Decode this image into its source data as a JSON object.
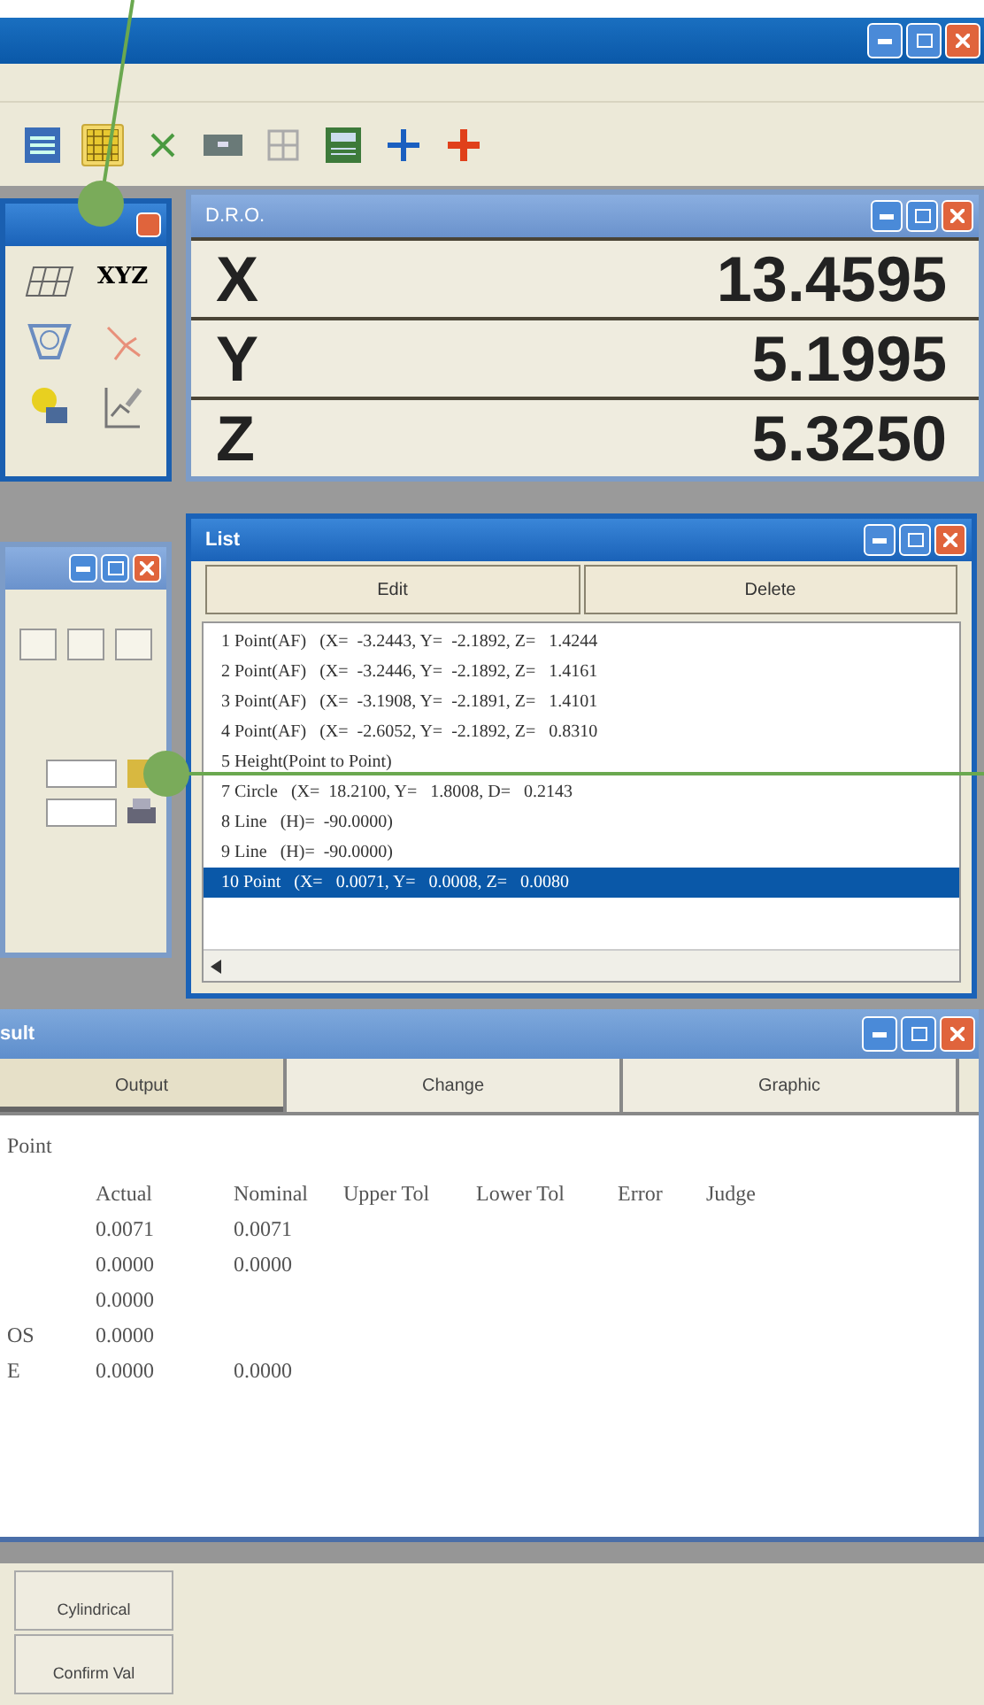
{
  "toolbar": [
    {
      "kind": "list",
      "selected": false
    },
    {
      "kind": "grid",
      "selected": true
    },
    {
      "kind": "cross",
      "selected": false
    },
    {
      "kind": "bar",
      "selected": false
    },
    {
      "kind": "panes",
      "selected": false
    },
    {
      "kind": "calc",
      "selected": false
    },
    {
      "kind": "plus-blue",
      "selected": false
    },
    {
      "kind": "plus-red",
      "selected": false
    }
  ],
  "tool_panel": {
    "icons": [
      {
        "kind": "grid"
      },
      {
        "kind": "text",
        "label": "XYZ"
      },
      {
        "kind": "hexagon"
      },
      {
        "kind": "rays"
      },
      {
        "kind": "bulb"
      },
      {
        "kind": "chart"
      }
    ]
  },
  "dro": {
    "title": "D.R.O.",
    "axes": [
      {
        "axis": "X",
        "value": "13.4595"
      },
      {
        "axis": "Y",
        "value": "5.1995"
      },
      {
        "axis": "Z",
        "value": "5.3250"
      }
    ]
  },
  "list": {
    "title": "List",
    "buttons": [
      "Edit",
      "Delete"
    ],
    "rows": [
      {
        "name": "1 Point(AF)",
        "value": "(X=  -3.2443, Y=  -2.1892, Z=   1.4244",
        "selected": false
      },
      {
        "name": "2 Point(AF)",
        "value": "(X=  -3.2446, Y=  -2.1892, Z=   1.4161",
        "selected": false
      },
      {
        "name": "3 Point(AF)",
        "value": "(X=  -3.1908, Y=  -2.1891, Z=   1.4101",
        "selected": false
      },
      {
        "name": "4 Point(AF)",
        "value": "(X=  -2.6052, Y=  -2.1892, Z=   0.8310",
        "selected": false
      },
      {
        "name": "5 Height(Point to Point)",
        "value": "",
        "selected": false
      },
      {
        "name": "7 Circle",
        "value": "(X=  18.2100, Y=   1.8008, D=   0.2143",
        "selected": false
      },
      {
        "name": "8 Line",
        "value": "(H)=  -90.0000)",
        "selected": false
      },
      {
        "name": "9 Line",
        "value": "(H)=  -90.0000)",
        "selected": false
      },
      {
        "name": "10 Point",
        "value": "(X=   0.0071, Y=   0.0008, Z=   0.0080",
        "selected": true
      }
    ]
  },
  "result": {
    "title": "sult",
    "tabs": [
      {
        "label": "Output",
        "selected": true
      },
      {
        "label": "Change",
        "selected": false
      },
      {
        "label": "Graphic",
        "selected": false
      }
    ],
    "heading": "Point",
    "columns": [
      "Actual",
      "Nominal",
      "Upper Tol",
      "Lower Tol",
      "Error",
      "Judge"
    ],
    "rows": [
      {
        "label": "",
        "cells": [
          "0.0071",
          "0.0071"
        ]
      },
      {
        "label": "",
        "cells": [
          "0.0000",
          "0.0000"
        ]
      },
      {
        "label": "",
        "cells": [
          "0.0000"
        ]
      },
      {
        "label": "OS",
        "cells": [
          "0.0000"
        ]
      },
      {
        "label": "E",
        "cells": [
          "0.0000",
          "0.0000"
        ]
      }
    ]
  },
  "bottom_buttons": [
    "Cylindrical",
    "Confirm Val"
  ]
}
